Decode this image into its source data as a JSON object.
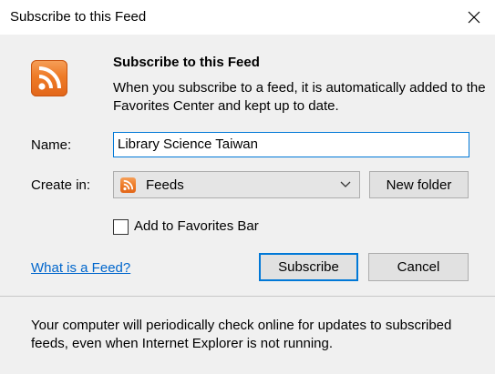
{
  "window": {
    "title": "Subscribe to this Feed"
  },
  "header": {
    "icon": "rss-feed-icon",
    "title": "Subscribe to this Feed",
    "description": "When you subscribe to a feed, it is automatically added to the Favorites Center and kept up to date."
  },
  "form": {
    "name_label": "Name:",
    "name_value": "Library Science Taiwan",
    "create_in_label": "Create in:",
    "create_in_value": "Feeds",
    "create_in_icon": "rss-feed-icon",
    "new_folder_label": "New folder",
    "add_to_favorites_label": "Add to Favorites Bar",
    "add_to_favorites_checked": false
  },
  "actions": {
    "help_link": "What is a Feed?",
    "subscribe_label": "Subscribe",
    "cancel_label": "Cancel"
  },
  "footer": {
    "note": "Your computer will periodically check online for updates to subscribed feeds, even when Internet Explorer is not running."
  },
  "colors": {
    "accent": "#0078d7",
    "link": "#0066cc",
    "rss_orange": "#ee7b27",
    "dialog_bg": "#f0f0f0"
  }
}
